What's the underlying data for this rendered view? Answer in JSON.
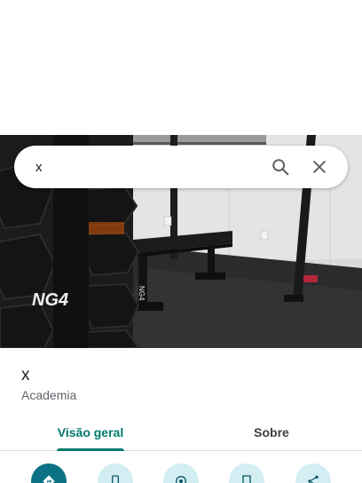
{
  "search": {
    "query": "x",
    "search_icon": "search-icon",
    "close_icon": "close-icon"
  },
  "photo": {
    "watermark": "NG4"
  },
  "place": {
    "name": "x",
    "category": "Academia"
  },
  "tabs": [
    {
      "label": "Visão geral",
      "active": true
    },
    {
      "label": "Sobre",
      "active": false
    }
  ],
  "actions": [
    {
      "icon": "directions-icon",
      "color": "#0b7285"
    },
    {
      "icon": "phone-icon",
      "color": "#d2eef3"
    },
    {
      "icon": "nearby-icon",
      "color": "#d2eef3"
    },
    {
      "icon": "save-icon",
      "color": "#d2eef3"
    },
    {
      "icon": "share-icon",
      "color": "#d2eef3"
    }
  ],
  "colors": {
    "accent": "#00796b",
    "primary_button": "#0b7285",
    "secondary_button": "#d2eef3"
  }
}
